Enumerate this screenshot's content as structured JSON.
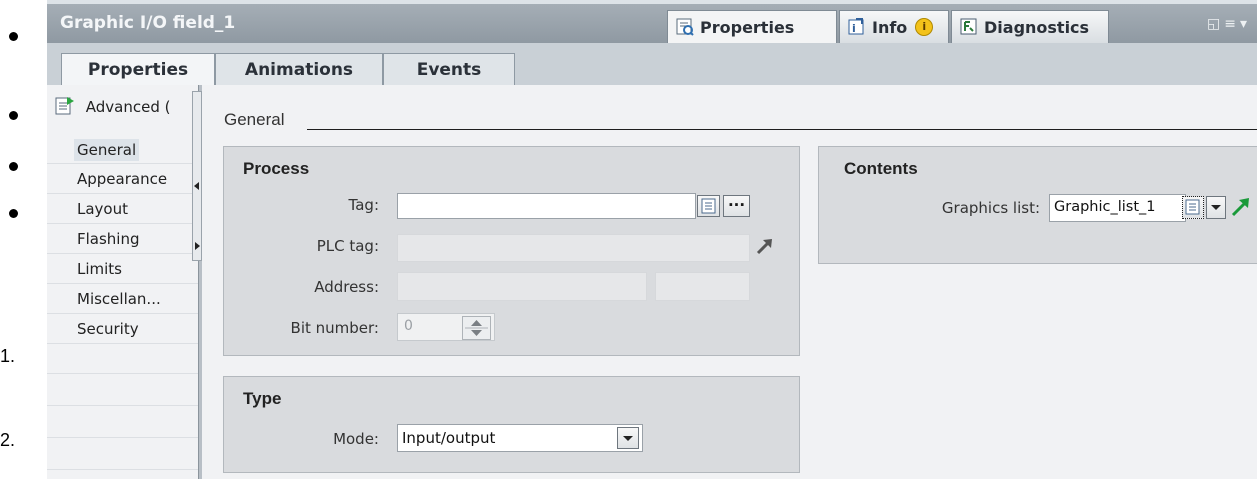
{
  "list_markers": {
    "numbers": [
      "1.",
      "2."
    ]
  },
  "window": {
    "title": "Graphic I/O field_1",
    "top_tabs": [
      {
        "label": "Properties",
        "icon": "properties-icon",
        "active": true
      },
      {
        "label": "Info",
        "icon": "info-icon",
        "active": false,
        "badge": "i"
      },
      {
        "label": "Diagnostics",
        "icon": "diagnostics-icon",
        "active": false
      }
    ]
  },
  "sub_tabs": [
    {
      "label": "Properties",
      "active": true
    },
    {
      "label": "Animations",
      "active": false
    },
    {
      "label": "Events",
      "active": false
    }
  ],
  "nav": {
    "header": "Advanced (",
    "items": [
      "General",
      "Appearance",
      "Layout",
      "Flashing",
      "Limits",
      "Miscellan...",
      "Security"
    ],
    "selected": "General"
  },
  "section_title": "General",
  "process": {
    "title": "Process",
    "tag_label": "Tag:",
    "tag_value": "",
    "plc_tag_label": "PLC tag:",
    "address_label": "Address:",
    "bit_number_label": "Bit number:",
    "bit_number_value": "0",
    "browse_button": "..."
  },
  "type": {
    "title": "Type",
    "mode_label": "Mode:",
    "mode_value": "Input/output"
  },
  "contents": {
    "title": "Contents",
    "graphics_list_label": "Graphics list:",
    "graphics_list_value": "Graphic_list_1"
  },
  "colors": {
    "titlebar": "#969fa8",
    "accent_green": "#1a9a3a"
  }
}
